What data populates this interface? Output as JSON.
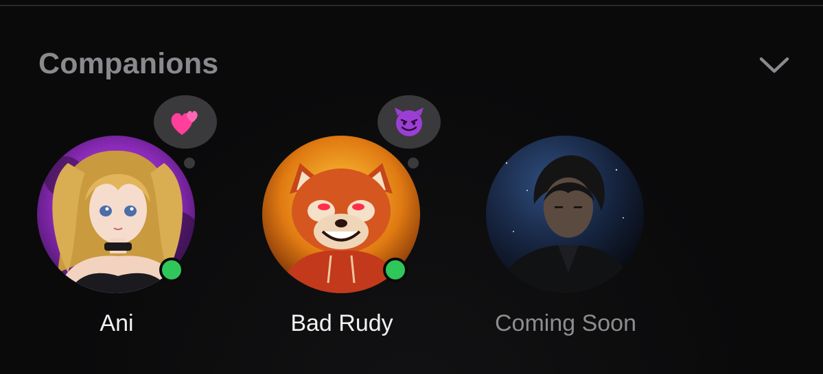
{
  "section": {
    "title": "Companions",
    "toggle_icon": "chevron-down-icon"
  },
  "companions": [
    {
      "name": "Ani",
      "online": true,
      "status_emoji": "two-hearts-icon",
      "avatar": "anime-girl-blonde-twin-tails"
    },
    {
      "name": "Bad Rudy",
      "online": true,
      "status_emoji": "smiling-imp-icon",
      "avatar": "red-panda-hoodie"
    },
    {
      "name": "Coming Soon",
      "online": false,
      "avatar": "dark-haired-man-in-suit"
    }
  ],
  "colors": {
    "background": "#0a0a0b",
    "title": "#8a8a8e",
    "online": "#2fc65a",
    "bubble": "#3a3a3d",
    "name": "#f2f2f2",
    "name_muted": "#8d8d90"
  }
}
